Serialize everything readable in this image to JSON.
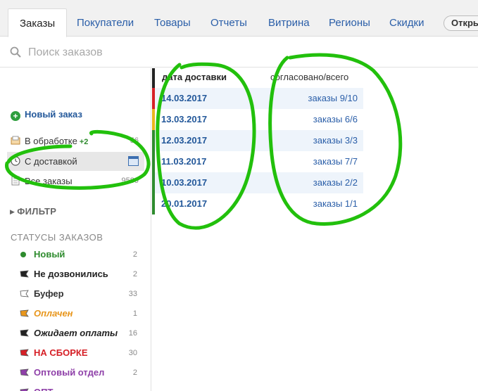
{
  "tabs": [
    {
      "label": "Заказы",
      "active": true
    },
    {
      "label": "Покупатели"
    },
    {
      "label": "Товары"
    },
    {
      "label": "Отчеты"
    },
    {
      "label": "Витрина"
    },
    {
      "label": "Регионы"
    },
    {
      "label": "Скидки"
    }
  ],
  "open_button": "Откры",
  "search": {
    "placeholder": "Поиск заказов"
  },
  "sidebar": {
    "new_order": "Новый заказ",
    "items": [
      {
        "label": "В обработке",
        "delta": "+2",
        "count": "56"
      },
      {
        "label": "С доставкой",
        "count": ""
      },
      {
        "label": "Все заказы",
        "count": "9589"
      }
    ],
    "filter": "ФИЛЬТР",
    "statuses_title": "СТАТУСЫ ЗАКАЗОВ",
    "statuses": [
      {
        "label": "Новый",
        "count": "2",
        "color": "#2e8b2e",
        "icon": "green-dot-icon"
      },
      {
        "label": "Не дозвонились",
        "count": "2",
        "color": "#222222",
        "icon": "black-flag-icon"
      },
      {
        "label": "Буфер",
        "count": "33",
        "color": "#333333",
        "icon": "white-flag-icon"
      },
      {
        "label": "Оплачен",
        "count": "1",
        "color": "#e8961c",
        "icon": "yellow-flag-icon"
      },
      {
        "label": "Ожидает оплаты",
        "count": "16",
        "color": "#222222",
        "icon": "black-flag-icon"
      },
      {
        "label": "НА СБОРКЕ",
        "count": "30",
        "color": "#d61f26",
        "icon": "red-flag-icon"
      },
      {
        "label": "Оптовый отдел",
        "count": "2",
        "color": "#8e3fa8",
        "icon": "purple-flag-icon"
      },
      {
        "label": "ОПТ",
        "count": "",
        "color": "#8e3fa8",
        "icon": "purple-flag-icon"
      }
    ]
  },
  "table": {
    "date_header": "дата доставки",
    "agreed_header": "согласовано/всего",
    "rows": [
      {
        "date": "14.03.2017",
        "agreed": "заказы 9/10",
        "bar": "#d61f26"
      },
      {
        "date": "13.03.2017",
        "agreed": "заказы 6/6",
        "bar": "#e8b51c"
      },
      {
        "date": "12.03.2017",
        "agreed": "заказы 3/3",
        "bar": "#2e8b2e"
      },
      {
        "date": "11.03.2017",
        "agreed": "заказы 7/7",
        "bar": "#2e8b2e"
      },
      {
        "date": "10.03.2017",
        "agreed": "заказы 2/2",
        "bar": "#2e8b2e"
      },
      {
        "date": "20.01.2017",
        "agreed": "заказы 1/1",
        "bar": "#2e8b2e"
      }
    ]
  },
  "colors": {
    "accent": "#23589a",
    "annotation": "#22c00c"
  }
}
